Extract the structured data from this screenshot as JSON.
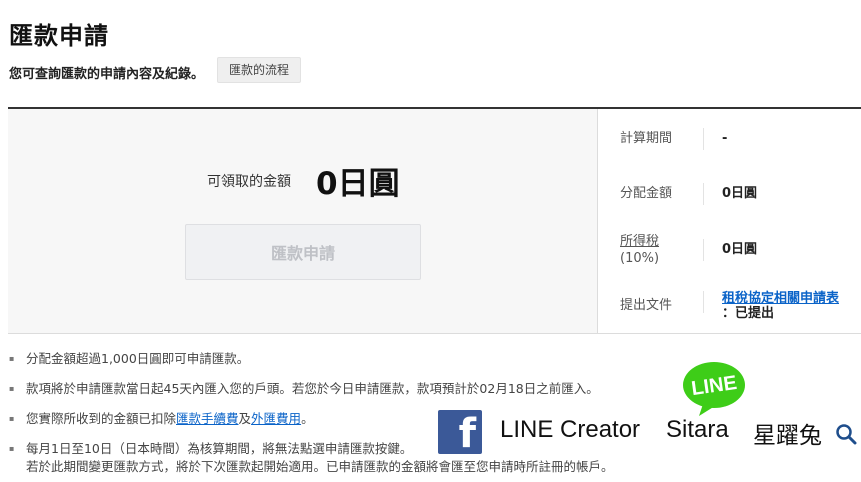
{
  "header": {
    "title": "匯款申請",
    "subtitle": "您可查詢匯款的申請內容及紀錄。",
    "flow_button": "匯款的流程"
  },
  "summary": {
    "amount_label": "可領取的金額",
    "amount_value": "0日圓",
    "withdraw_button": "匯款申請"
  },
  "details": {
    "period_label": "計算期間",
    "period_value": "-",
    "distribution_label": "分配金額",
    "distribution_value": "0日圓",
    "tax_label_line1": "所得稅",
    "tax_label_line2": "(10%)",
    "tax_value": "0日圓",
    "docs_label": "提出文件",
    "docs_link": "租稅協定相關申請表",
    "docs_status": "：已提出"
  },
  "notes": {
    "n1": "分配金額超過1,000日圓即可申請匯款。",
    "n2": "款項將於申請匯款當日起45天內匯入您的戶頭。若您於今日申請匯款，款項預計於02月18日之前匯入。",
    "n3_pre": "您實際所收到的金額已扣除",
    "n3_link1": "匯款手續費",
    "n3_mid": "及",
    "n3_link2": "外匯費用",
    "n3_post": "。",
    "n4_line1": "每月1日至10日（日本時間）為核算期間，將無法點選申請匯款按鍵。",
    "n4_line2": "若於此期間變更匯款方式，將於下次匯款起開始適用。已申請匯款的金額將會匯至您申請時所註冊的帳戶。"
  },
  "watermark": {
    "line_badge": "LINE",
    "creator": "LINE Creator",
    "name": "Sitara",
    "cn_name": "星躍兔",
    "icons": [
      "facebook-logo",
      "line-logo",
      "search-icon"
    ]
  },
  "colors": {
    "link": "#0a63c8",
    "line_green": "#3ecd18",
    "facebook_blue": "#3b5998"
  }
}
